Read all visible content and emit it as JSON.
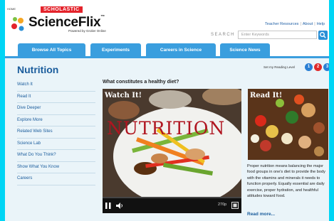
{
  "header": {
    "home": "HOME",
    "brand": "SCHOLASTIC",
    "logo": "ScienceFlix",
    "logo_tm": "™",
    "powered": "Powered by Grolier Online",
    "links": [
      "Teacher Resources",
      "About",
      "Help"
    ],
    "search_label": "SEARCH",
    "search_placeholder": "Enter Keywords"
  },
  "tabs": [
    "Browse All Topics",
    "Experiments",
    "Careers in Science",
    "Science News"
  ],
  "page": {
    "title": "Nutrition",
    "reading_label": "Set my Reading Level",
    "levels": [
      "1",
      "2",
      "3"
    ],
    "level_colors": [
      "#2a7fd4",
      "#e02a2a",
      "#2a7fd4"
    ]
  },
  "sidebar": [
    "Watch It",
    "Read It",
    "Dive Deeper",
    "Explore More",
    "Related Web Sites",
    "Science Lab",
    "What Do You Think?",
    "Show What You Know",
    "Careers"
  ],
  "video": {
    "question": "What constitutes a healthy diet?",
    "badge": "Watch It!",
    "overlay": "NUTRITION",
    "quality": "270p"
  },
  "read": {
    "badge": "Read It!",
    "text": "Proper nutrition means balancing the major food groups in one's diet to provide the body with the vitamins and minerals it needs to function properly. Equally essential are daily exercise, proper hydration, and healthful attitudes toward food.",
    "more": "Read more..."
  },
  "colors": {
    "accent": "#3a9ede",
    "brand_red": "#e4232b",
    "link": "#1a5c9c",
    "frame": "#00d5f5"
  }
}
